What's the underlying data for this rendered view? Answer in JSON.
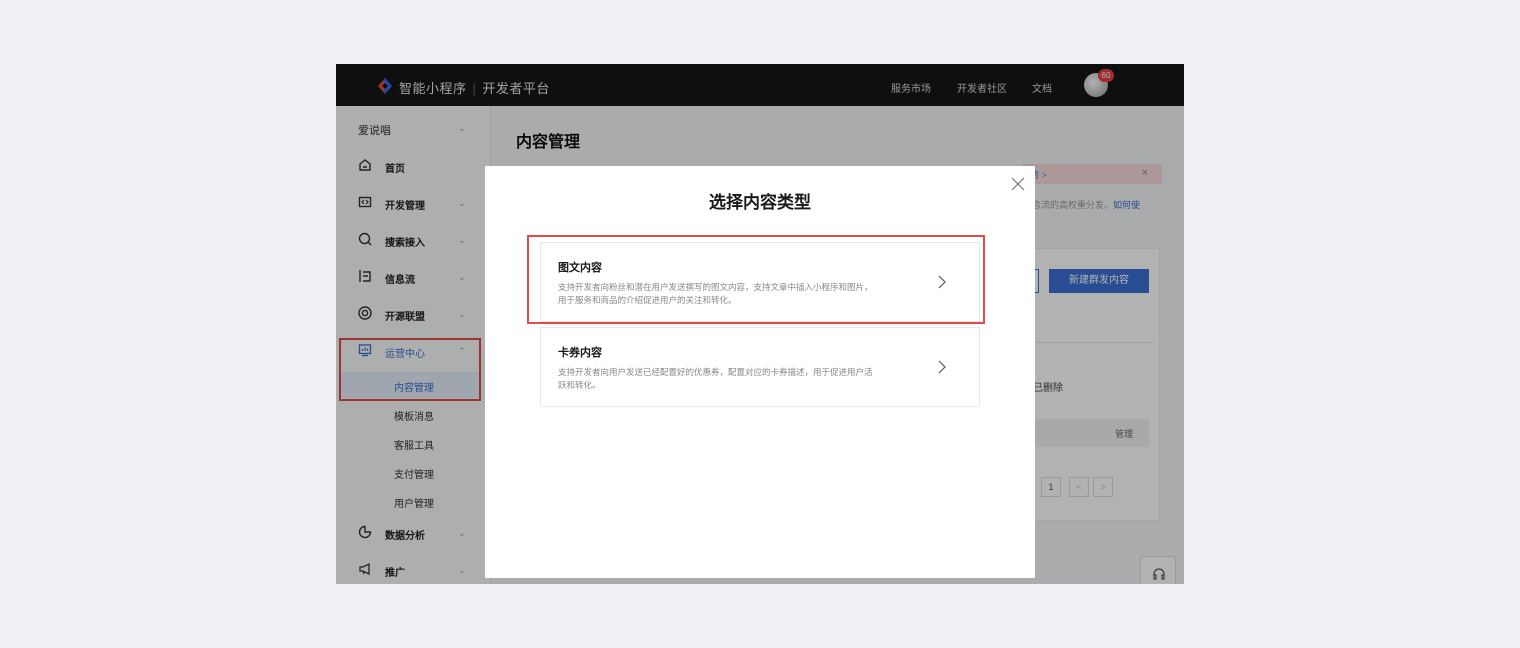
{
  "topbar": {
    "brand": "智能小程序",
    "platform": "开发者平台",
    "nav": [
      "服务市场",
      "开发者社区",
      "文档"
    ],
    "notification_count": "60"
  },
  "sidebar": {
    "project": "爱说唱",
    "items": [
      {
        "label": "首页",
        "icon": "home-icon"
      },
      {
        "label": "开发管理",
        "icon": "code-icon"
      },
      {
        "label": "搜索接入",
        "icon": "search-icon"
      },
      {
        "label": "信息流",
        "icon": "feed-icon"
      },
      {
        "label": "开源联盟",
        "icon": "alliance-icon"
      },
      {
        "label": "运营中心",
        "icon": "operations-icon"
      },
      {
        "label": "数据分析",
        "icon": "chart-icon"
      },
      {
        "label": "推广",
        "icon": "megaphone-icon"
      }
    ],
    "subitems": [
      "内容管理",
      "模板消息",
      "客服工具",
      "支付管理",
      "用户管理"
    ],
    "active_item": "运营中心",
    "active_subitem": "内容管理"
  },
  "main": {
    "title": "内容管理",
    "notice_text": "情 >",
    "notice_close": "×",
    "desc_text": "息流的高权重分发。",
    "desc_link": "如何使",
    "new_button": "新建群发内容",
    "deleted_tab": "已删除",
    "table_header": "管理",
    "page_number": "1",
    "prev": "<",
    "next": ">"
  },
  "modal": {
    "title": "选择内容类型",
    "options": [
      {
        "title": "图文内容",
        "desc_line1": "支持开发者向粉丝和潜在用户发送撰写的图文内容，支持文章中插入小程序和图片，",
        "desc_line2": "用于服务和商品的介绍促进用户的关注和转化。"
      },
      {
        "title": "卡券内容",
        "desc_line1": "支持开发者向用户发送已经配置好的优惠券，配置对应的卡券描述，用于促进用户活",
        "desc_line2": "跃和转化。"
      }
    ]
  },
  "colors": {
    "accent": "#3a6fd1",
    "highlight_box": "#e04b4b",
    "topbar": "#161616"
  }
}
